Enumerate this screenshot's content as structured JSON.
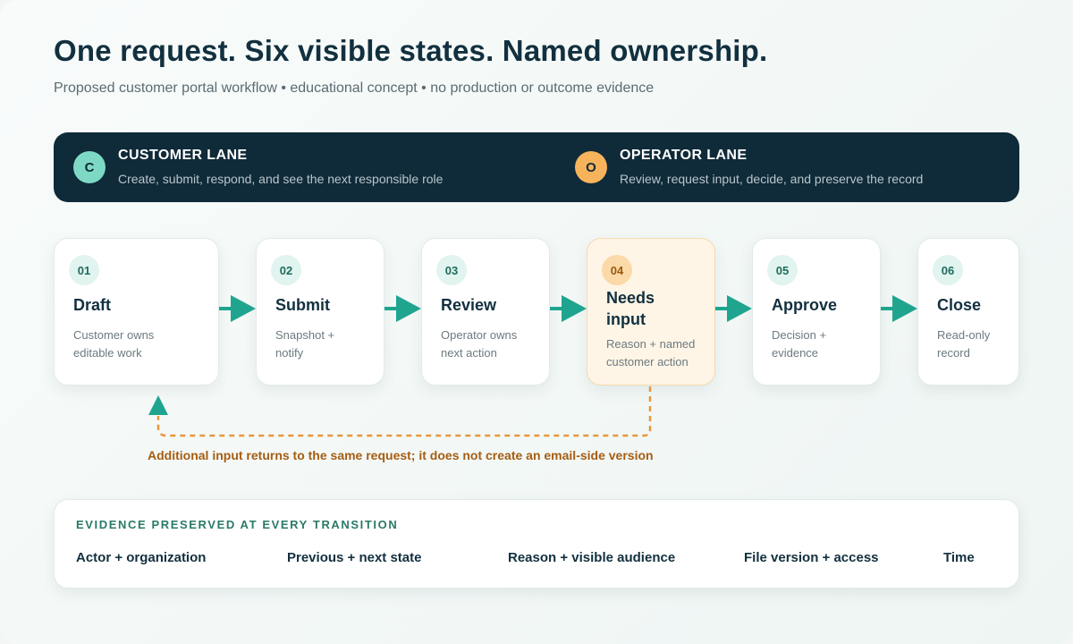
{
  "header": {
    "title": "One request. Six visible states. Named ownership.",
    "subtitle": "Proposed customer portal workflow • educational concept • no production or outcome evidence"
  },
  "lanes": {
    "customer": {
      "badge": "C",
      "title": "CUSTOMER LANE",
      "description": "Create, submit, respond, and see the next responsible role",
      "color": "#7dd9c4"
    },
    "operator": {
      "badge": "O",
      "title": "OPERATOR LANE",
      "description": "Review, request input, decide, and preserve the record",
      "color": "#f7b35c"
    }
  },
  "steps": [
    {
      "number": "01",
      "name": "Draft",
      "description": "Customer owns editable work"
    },
    {
      "number": "02",
      "name": "Submit",
      "description": "Snapshot + notify"
    },
    {
      "number": "03",
      "name": "Review",
      "description": "Operator owns next action"
    },
    {
      "number": "04",
      "name": "Needs input",
      "description": "Reason + named customer action"
    },
    {
      "number": "05",
      "name": "Approve",
      "description": "Decision + evidence"
    },
    {
      "number": "06",
      "name": "Close",
      "description": "Read-only record"
    }
  ],
  "loop": {
    "note": "Additional input returns to the same request; it does not create an email-side version"
  },
  "evidence": {
    "title": "EVIDENCE PRESERVED AT EVERY TRANSITION",
    "items": [
      "Actor + organization",
      "Previous + next state",
      "Reason + visible audience",
      "File version + access",
      "Time"
    ]
  },
  "colors": {
    "arrow": "#1fa58f",
    "loop": "#e8973a",
    "dark": "#0f2a38"
  }
}
